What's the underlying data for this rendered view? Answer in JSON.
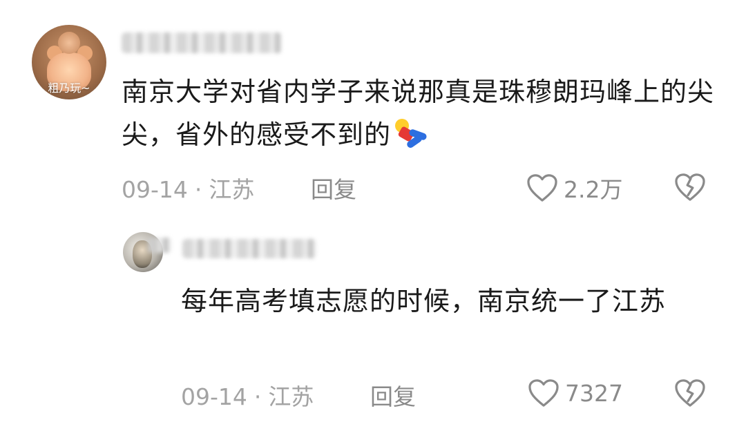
{
  "top_comment": {
    "avatar_caption": "粗乃玩~",
    "text": "南京大学对省内学子来说那真是珠穆朗玛峰上的尖尖，省外的感受不到的",
    "date": "09-14",
    "location": "江苏",
    "reply_label": "回复",
    "like_count": "2.2万"
  },
  "reply_comment": {
    "text": "每年高考填志愿的时候，南京统一了江苏",
    "date": "09-14",
    "location": "江苏",
    "reply_label": "回复",
    "like_count": "7327"
  },
  "meta_separator": "·",
  "colors": {
    "text": "#1a1a1a",
    "meta": "#a3a3a3",
    "icon": "#8a8a8a",
    "background": "#ffffff"
  },
  "icons": [
    "heart-outline-icon",
    "broken-heart-icon",
    "falling-figure-emoji"
  ]
}
